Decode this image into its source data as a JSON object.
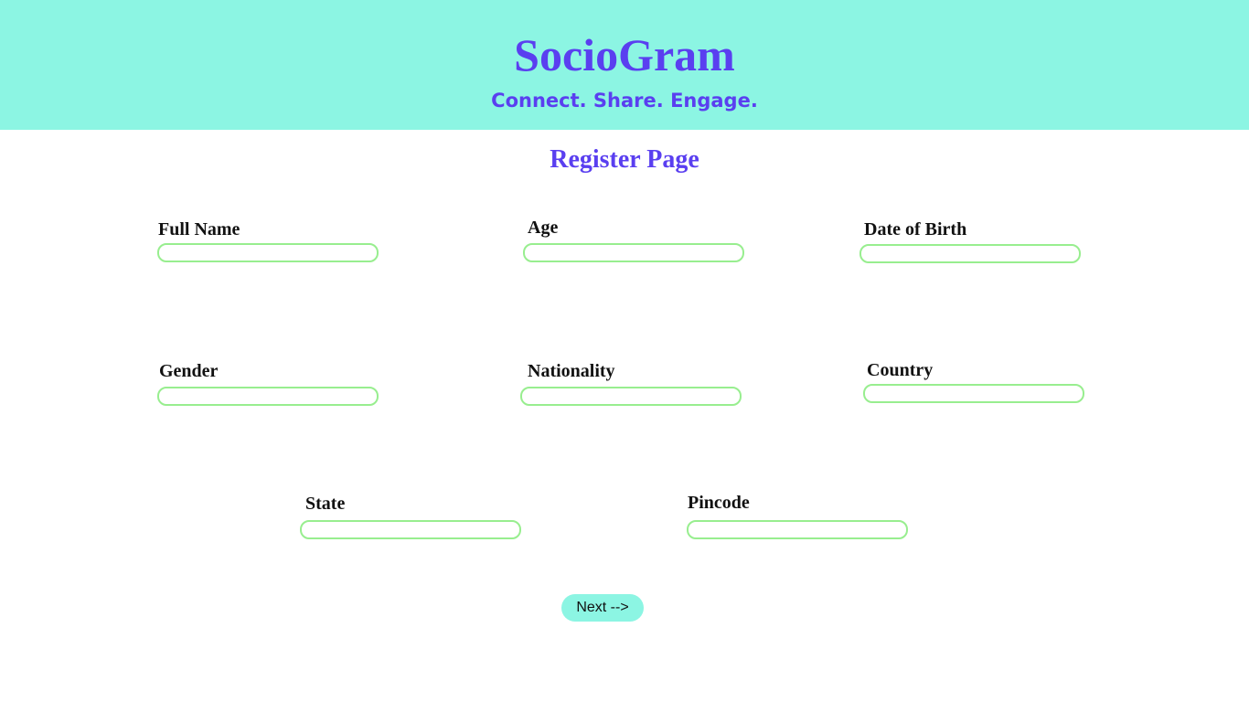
{
  "header": {
    "brand": "SocioGram",
    "tagline": "Connect. Share. Engage."
  },
  "page": {
    "title": "Register Page"
  },
  "form": {
    "full_name": {
      "label": "Full Name",
      "value": ""
    },
    "age": {
      "label": "Age",
      "value": ""
    },
    "dob": {
      "label": "Date of Birth",
      "value": ""
    },
    "gender": {
      "label": "Gender",
      "value": ""
    },
    "nationality": {
      "label": "Nationality",
      "value": ""
    },
    "country": {
      "label": "Country",
      "value": ""
    },
    "state": {
      "label": "State",
      "value": ""
    },
    "pincode": {
      "label": "Pincode",
      "value": ""
    }
  },
  "actions": {
    "next_label": "Next -->"
  },
  "colors": {
    "header_bg": "#8cf5e3",
    "brand": "#5a3ff0",
    "input_border": "#98ee8f",
    "button_bg": "#8cf5e3"
  }
}
